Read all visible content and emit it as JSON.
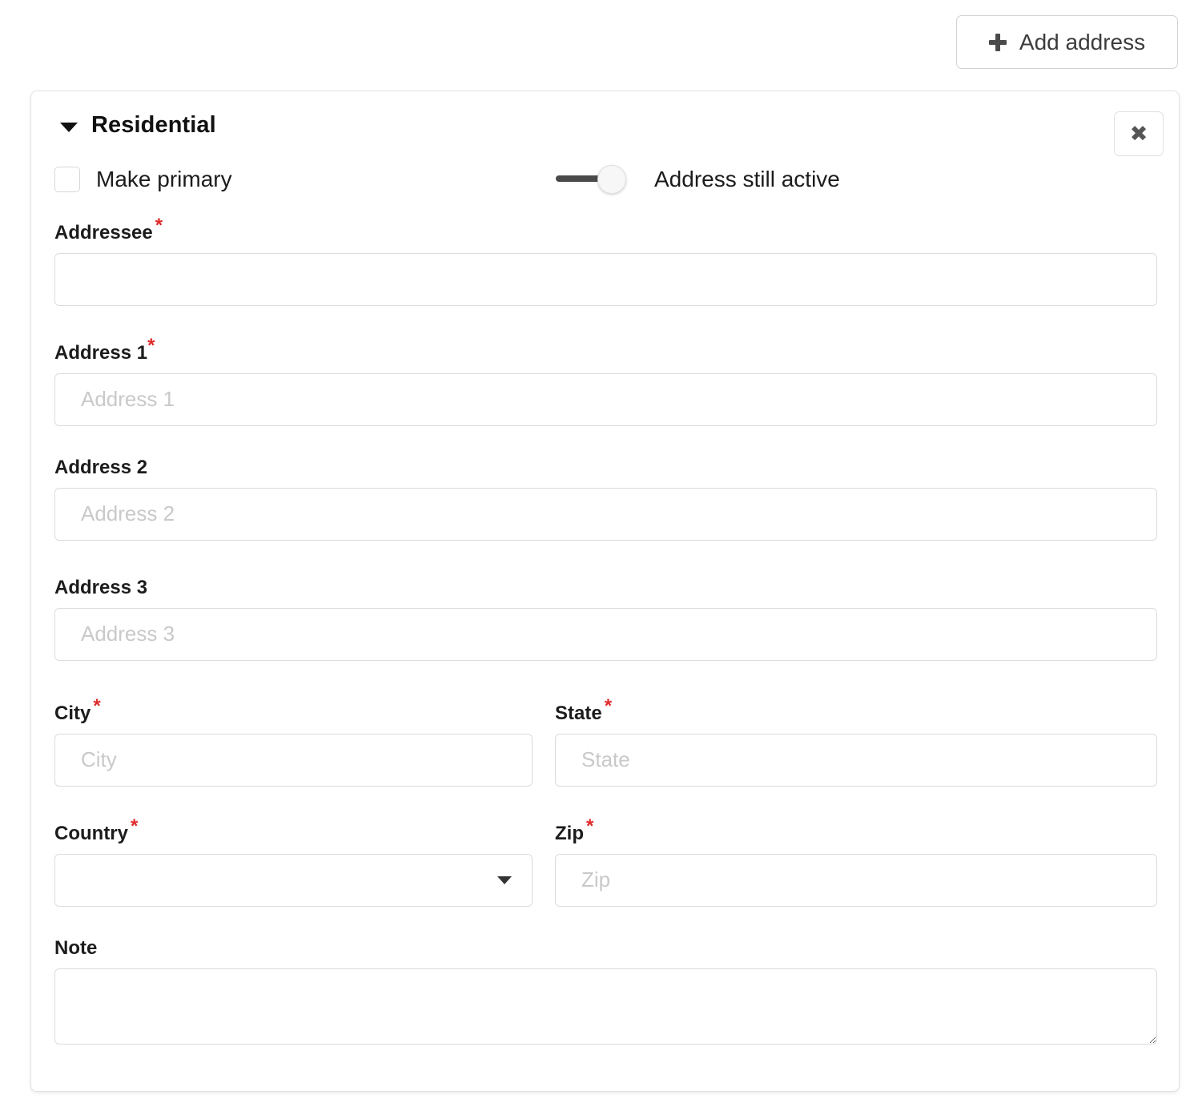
{
  "toolbar": {
    "add_address_label": "Add address",
    "add_icon": "plus-icon"
  },
  "card": {
    "title": "Residential",
    "collapse_icon": "caret-down-icon",
    "close_icon": "close-icon",
    "close_glyph": "✖",
    "options": {
      "make_primary_label": "Make primary",
      "make_primary_checked": false,
      "active_toggle_label": "Address still active",
      "active_toggle_on": true
    },
    "fields": {
      "addressee": {
        "label": "Addressee",
        "required": true,
        "required_mark": "*",
        "value": "",
        "placeholder": ""
      },
      "address1": {
        "label": "Address 1",
        "required": true,
        "required_mark": "*",
        "value": "",
        "placeholder": "Address 1"
      },
      "address2": {
        "label": "Address 2",
        "required": false,
        "required_mark": "",
        "value": "",
        "placeholder": "Address 2"
      },
      "address3": {
        "label": "Address 3",
        "required": false,
        "required_mark": "",
        "value": "",
        "placeholder": "Address 3"
      },
      "city": {
        "label": "City",
        "required": true,
        "required_mark": "*",
        "value": "",
        "placeholder": "City"
      },
      "state": {
        "label": "State",
        "required": true,
        "required_mark": "*",
        "value": "",
        "placeholder": "State"
      },
      "country": {
        "label": "Country",
        "required": true,
        "required_mark": "*",
        "value": "",
        "placeholder": "",
        "caret_icon": "chevron-down-icon"
      },
      "zip": {
        "label": "Zip",
        "required": true,
        "required_mark": "*",
        "value": "",
        "placeholder": "Zip"
      },
      "note": {
        "label": "Note",
        "required": false,
        "required_mark": "",
        "value": "",
        "placeholder": ""
      }
    }
  },
  "colors": {
    "required_asterisk": "#e02b2b",
    "label_text": "#1c1c1c",
    "placeholder": "#c9c9c9",
    "border": "#dcdcdc",
    "card_border": "#e2e2e2",
    "toggle_track": "#4a4a4a",
    "background": "#ffffff"
  }
}
